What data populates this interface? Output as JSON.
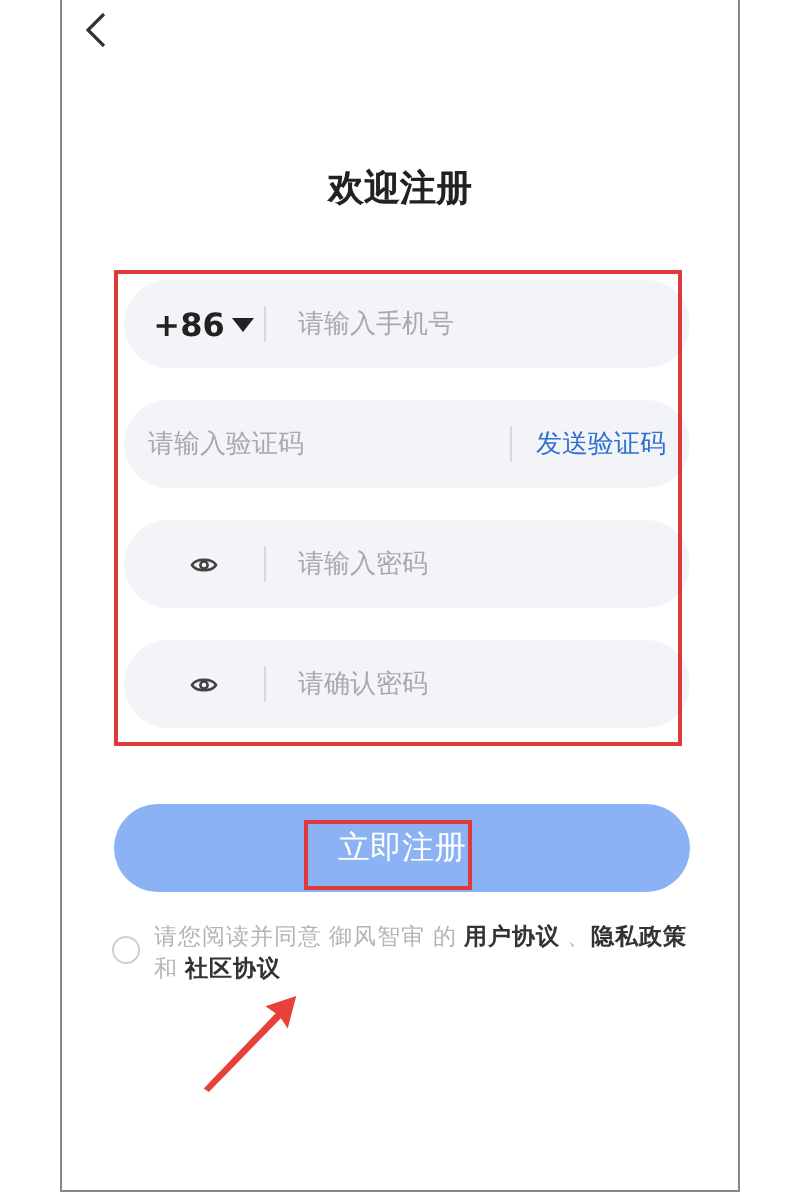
{
  "title": "欢迎注册",
  "fields": [
    {
      "kind": "phone",
      "prefix": "+86",
      "placeholder": "请输入手机号"
    },
    {
      "kind": "code",
      "placeholder": "请输入验证码",
      "action": "发送验证码"
    },
    {
      "kind": "password",
      "placeholder": "请输入密码"
    },
    {
      "kind": "password",
      "placeholder": "请确认密码"
    }
  ],
  "submit": {
    "label": "立即注册"
  },
  "agreement": {
    "checked": false,
    "parts": [
      {
        "text": "请您阅读并同意 御风智审 的 ",
        "kind": "text"
      },
      {
        "text": "用户协议",
        "kind": "link"
      },
      {
        "text": " 、",
        "kind": "text"
      },
      {
        "text": "隐私政策",
        "kind": "link"
      },
      {
        "text": " 和 ",
        "kind": "text"
      },
      {
        "text": "社区协议",
        "kind": "link"
      }
    ]
  }
}
